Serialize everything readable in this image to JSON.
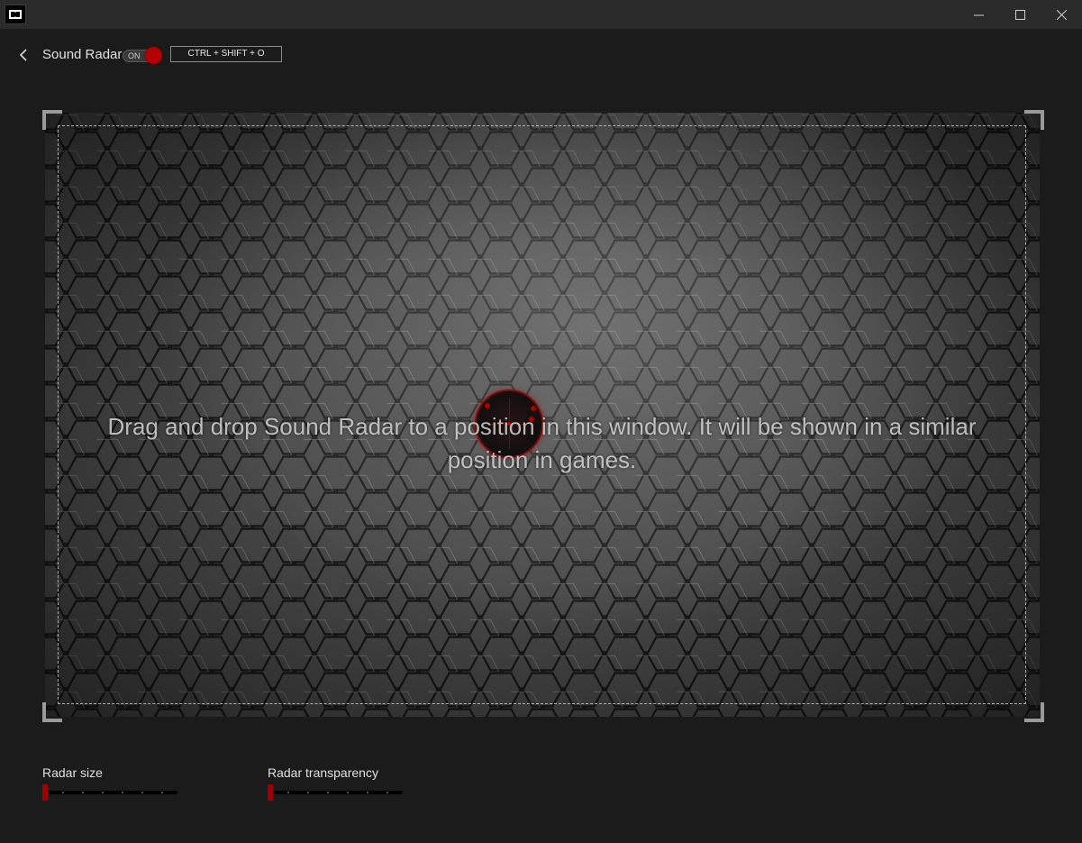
{
  "window": {
    "app_icon": "dolby-logo-icon",
    "minimize_icon": "minimize-icon",
    "maximize_icon": "maximize-icon",
    "close_icon": "close-icon"
  },
  "header": {
    "back_icon": "chevron-left-icon",
    "title": "Sound Radar",
    "toggle": {
      "label": "ON",
      "state": "on",
      "accent": "#b40000"
    },
    "shortcut": "CTRL + SHIFT + O"
  },
  "preview": {
    "instruction": "Drag and drop Sound Radar to a position in this window. It will be shown in a similar position in games.",
    "radar_icon": "sound-radar-icon"
  },
  "controls": {
    "radar_size": {
      "label": "Radar size",
      "value": 0
    },
    "radar_transparency": {
      "label": "Radar transparency",
      "value": 0
    }
  }
}
